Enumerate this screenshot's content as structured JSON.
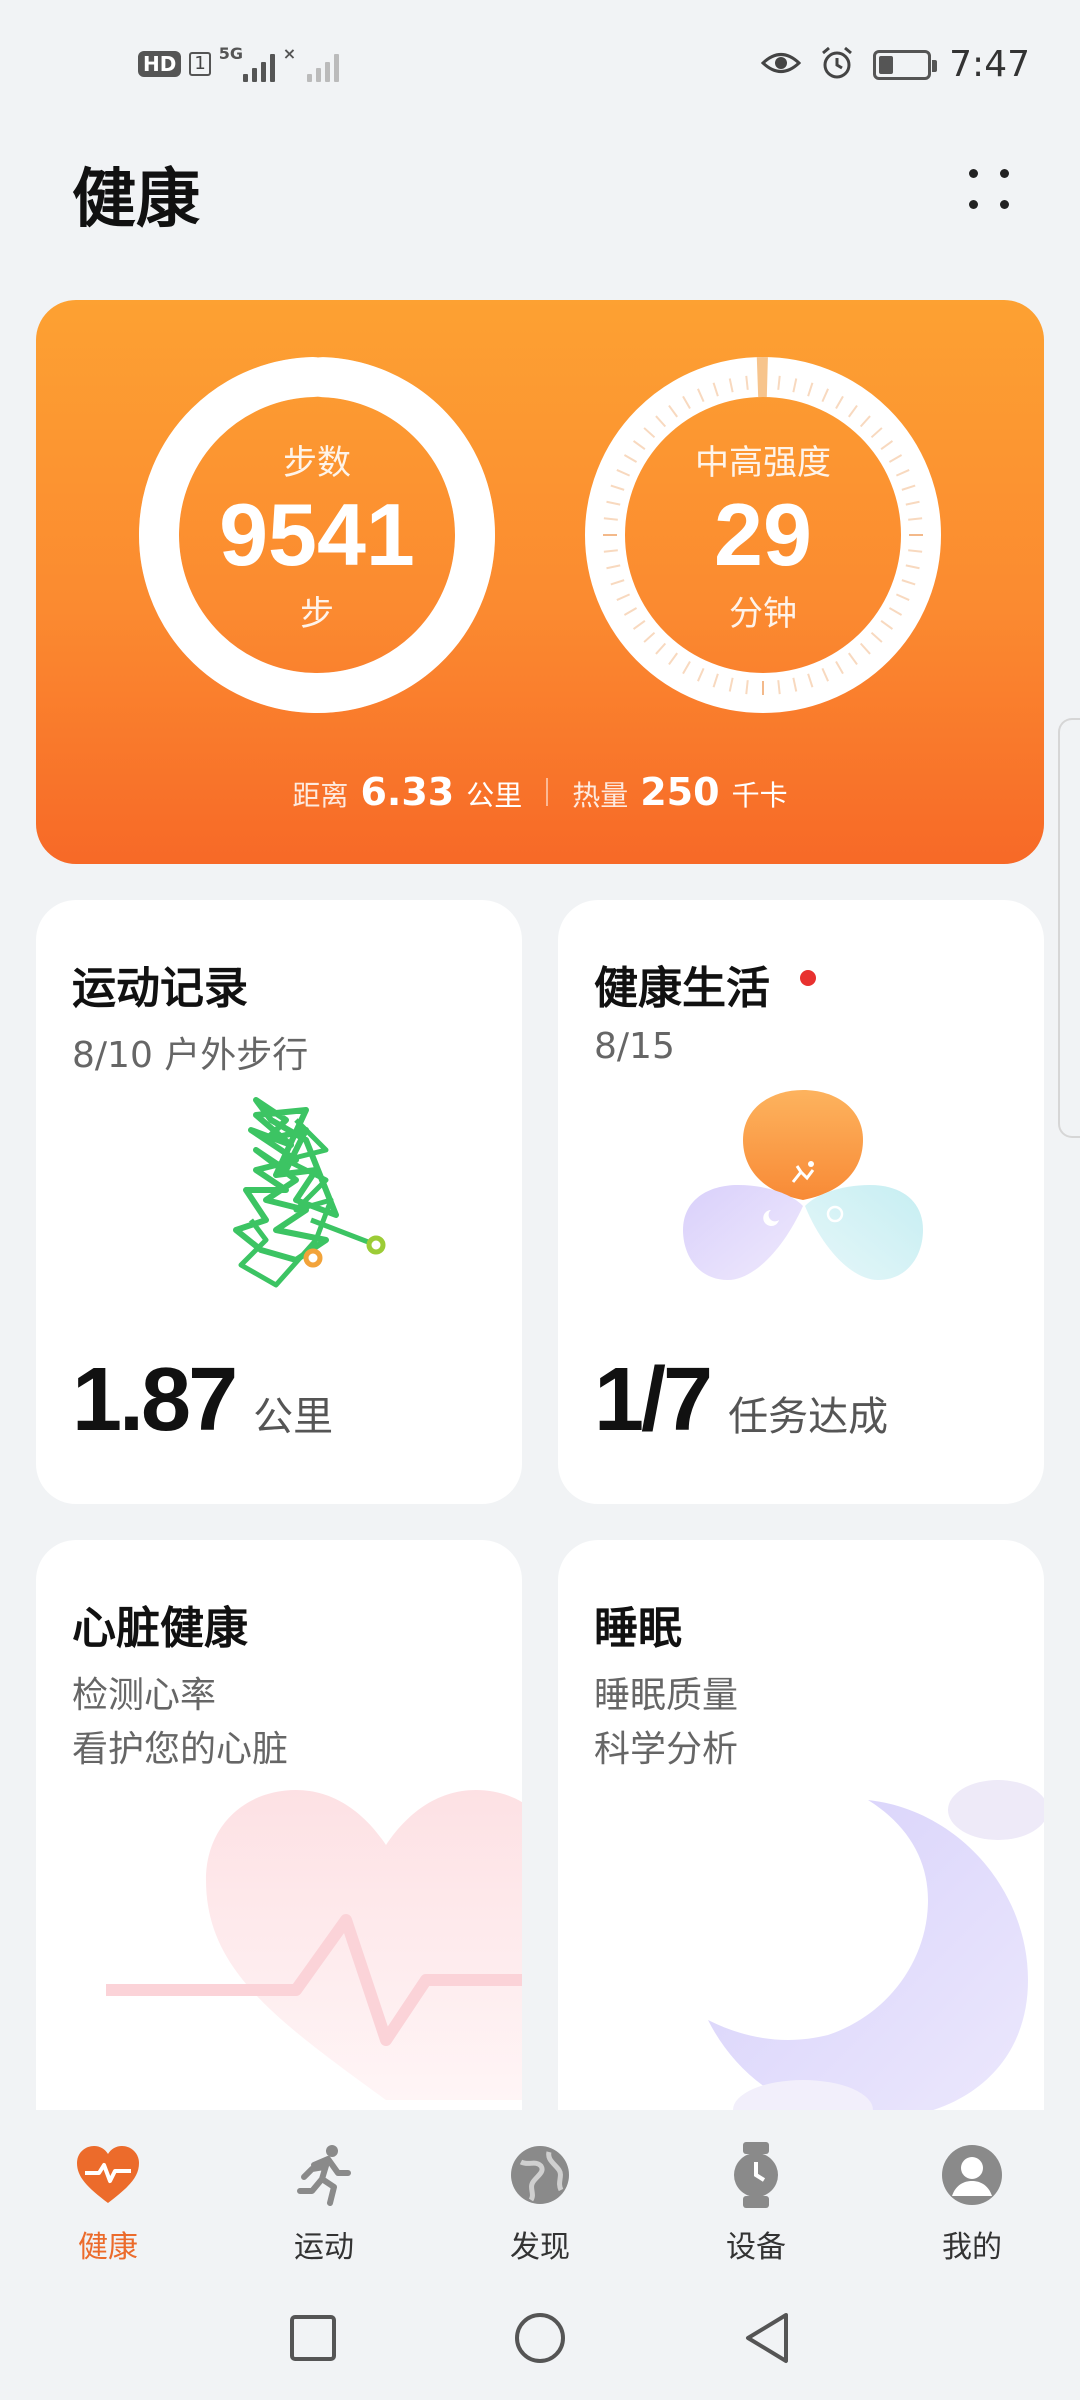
{
  "status_bar": {
    "hd": "HD",
    "sim": "1",
    "network": "5G",
    "network2": "×",
    "time": "7:47",
    "battery_level": 0.3
  },
  "header": {
    "title": "健康",
    "more_icon": "more-dots-icon"
  },
  "activity": {
    "steps": {
      "label": "步数",
      "value": "9541",
      "unit": "步",
      "progress": 0.99
    },
    "intensity": {
      "label": "中高强度",
      "value": "29",
      "unit": "分钟",
      "progress": 0.01
    },
    "distance_label": "距离",
    "distance_value": "6.33",
    "distance_unit": "公里",
    "calories_label": "热量",
    "calories_value": "250",
    "calories_unit": "千卡"
  },
  "cards": {
    "exercise": {
      "title": "运动记录",
      "subtitle": "8/10 户外步行",
      "value": "1.87",
      "unit": "公里"
    },
    "healthy_living": {
      "title": "健康生活",
      "subtitle": "8/15",
      "value": "1/7",
      "unit": "任务达成"
    },
    "heart": {
      "title": "心脏健康",
      "line1": "检测心率",
      "line2": "看护您的心脏"
    },
    "sleep": {
      "title": "睡眠",
      "line1": "睡眠质量",
      "line2": "科学分析"
    }
  },
  "bottom_nav": [
    {
      "label": "健康",
      "icon": "heart-pulse-icon",
      "active": true
    },
    {
      "label": "运动",
      "icon": "running-icon",
      "active": false
    },
    {
      "label": "发现",
      "icon": "globe-icon",
      "active": false
    },
    {
      "label": "设备",
      "icon": "watch-icon",
      "active": false
    },
    {
      "label": "我的",
      "icon": "profile-icon",
      "active": false
    }
  ],
  "colors": {
    "accent": "#ec6b2b",
    "card_top": "#fda132",
    "card_bottom": "#f76927",
    "route": "#3cc463"
  }
}
